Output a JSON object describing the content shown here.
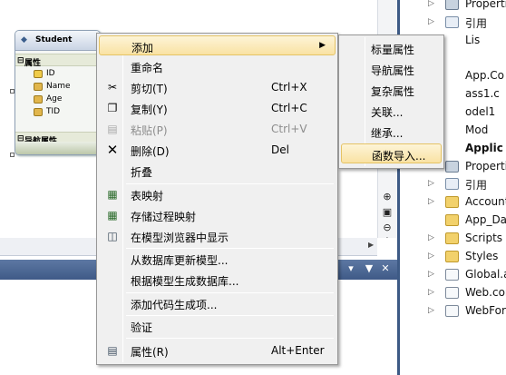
{
  "entity": {
    "name": "Student",
    "properties_section": "属性",
    "properties": [
      "ID",
      "Name",
      "Age",
      "TID"
    ],
    "nav_section": "导航属性"
  },
  "context_menu": {
    "items": [
      {
        "label": "添加",
        "shortcut": "",
        "icon": "",
        "has_submenu": true,
        "highlighted": true,
        "disabled": false
      },
      {
        "label": "重命名",
        "shortcut": "",
        "icon": "",
        "has_submenu": false,
        "highlighted": false,
        "disabled": false
      },
      {
        "label": "剪切(T)",
        "shortcut": "Ctrl+X",
        "icon": "scissors-icon",
        "has_submenu": false,
        "highlighted": false,
        "disabled": false
      },
      {
        "label": "复制(Y)",
        "shortcut": "Ctrl+C",
        "icon": "copy-icon",
        "has_submenu": false,
        "highlighted": false,
        "disabled": false
      },
      {
        "label": "粘贴(P)",
        "shortcut": "Ctrl+V",
        "icon": "paste-icon",
        "has_submenu": false,
        "highlighted": false,
        "disabled": true
      },
      {
        "label": "删除(D)",
        "shortcut": "Del",
        "icon": "delete-icon",
        "has_submenu": false,
        "highlighted": false,
        "disabled": false
      },
      {
        "label": "折叠",
        "shortcut": "",
        "icon": "",
        "has_submenu": false,
        "highlighted": false,
        "disabled": false
      },
      {
        "label": "表映射",
        "shortcut": "",
        "icon": "table-mapping-icon",
        "has_submenu": false,
        "highlighted": false,
        "disabled": false
      },
      {
        "label": "存储过程映射",
        "shortcut": "",
        "icon": "sproc-mapping-icon",
        "has_submenu": false,
        "highlighted": false,
        "disabled": false
      },
      {
        "label": "在模型浏览器中显示",
        "shortcut": "",
        "icon": "model-browser-icon",
        "has_submenu": false,
        "highlighted": false,
        "disabled": false
      },
      {
        "label": "从数据库更新模型...",
        "shortcut": "",
        "icon": "",
        "has_submenu": false,
        "highlighted": false,
        "disabled": false
      },
      {
        "label": "根据模型生成数据库...",
        "shortcut": "",
        "icon": "",
        "has_submenu": false,
        "highlighted": false,
        "disabled": false
      },
      {
        "label": "添加代码生成项...",
        "shortcut": "",
        "icon": "",
        "has_submenu": false,
        "highlighted": false,
        "disabled": false
      },
      {
        "label": "验证",
        "shortcut": "",
        "icon": "",
        "has_submenu": false,
        "highlighted": false,
        "disabled": false
      },
      {
        "label": "属性(R)",
        "shortcut": "Alt+Enter",
        "icon": "properties-icon",
        "has_submenu": false,
        "highlighted": false,
        "disabled": false
      }
    ]
  },
  "submenu": {
    "items": [
      {
        "label": "标量属性",
        "highlighted": false
      },
      {
        "label": "导航属性",
        "highlighted": false
      },
      {
        "label": "复杂属性",
        "highlighted": false
      },
      {
        "label": "关联...",
        "highlighted": false
      },
      {
        "label": "继承...",
        "highlighted": false
      },
      {
        "label": "函数导入...",
        "highlighted": true
      }
    ]
  },
  "solution_explorer": {
    "rows": [
      {
        "label": "Properti",
        "icon": "wrench"
      },
      {
        "label": "引用",
        "icon": "refs"
      },
      {
        "label": "Lis",
        "icon": "file"
      },
      {
        "label": "App.Co",
        "icon": "file"
      },
      {
        "label": "ass1.c",
        "icon": "file"
      },
      {
        "label": "odel1",
        "icon": "file"
      },
      {
        "label": "Mod",
        "icon": "file"
      },
      {
        "label": "Applic",
        "icon": "globe"
      },
      {
        "label": "Properti",
        "icon": "wrench"
      },
      {
        "label": "引用",
        "icon": "refs"
      },
      {
        "label": "Account",
        "icon": "folder"
      },
      {
        "label": "App_Dat",
        "icon": "folder"
      },
      {
        "label": "Scripts",
        "icon": "folder"
      },
      {
        "label": "Styles",
        "icon": "folder"
      },
      {
        "label": "Global.a",
        "icon": "file"
      },
      {
        "label": "Web.con",
        "icon": "file"
      },
      {
        "label": "WebFor",
        "icon": "file"
      }
    ]
  },
  "toolwindow": {
    "dropdown_icon": "dropdown-arrow-icon",
    "pin_icon": "pin-icon",
    "close_icon": "close-icon"
  },
  "colors": {
    "highlight": "#f9e2a3",
    "menu_bg": "#f0f0f0",
    "titlebar": "#4b6893"
  }
}
